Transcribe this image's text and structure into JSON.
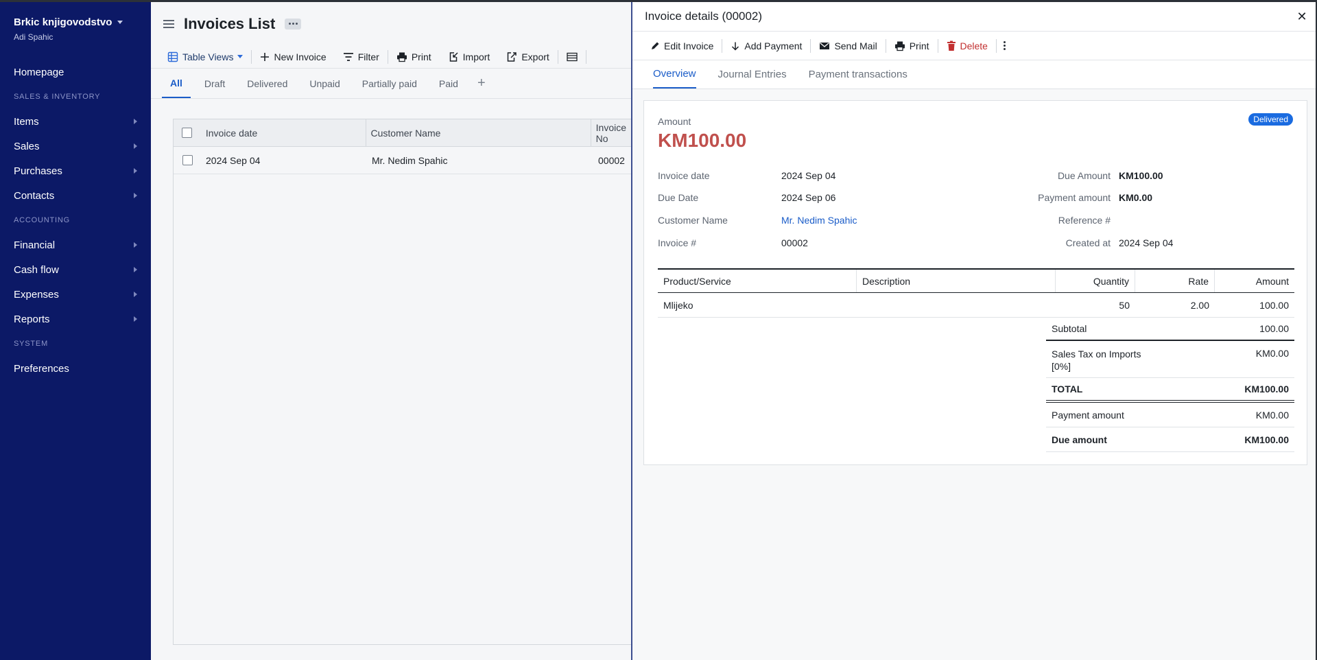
{
  "sidebar": {
    "org_name": "Brkic knjigovodstvo",
    "user_name": "Adi Spahic",
    "items": [
      {
        "label": "Homepage"
      },
      {
        "section": "SALES & INVENTORY"
      },
      {
        "label": "Items"
      },
      {
        "label": "Sales"
      },
      {
        "label": "Purchases"
      },
      {
        "label": "Contacts"
      },
      {
        "section": "ACCOUNTING"
      },
      {
        "label": "Financial"
      },
      {
        "label": "Cash flow"
      },
      {
        "label": "Expenses"
      },
      {
        "label": "Reports"
      },
      {
        "section": "SYSTEM"
      },
      {
        "label": "Preferences"
      }
    ]
  },
  "main": {
    "title": "Invoices List",
    "toolbar": {
      "table_views": "Table Views",
      "new_invoice": "New Invoice",
      "filter": "Filter",
      "print": "Print",
      "import": "Import",
      "export": "Export"
    },
    "tabs": [
      "All",
      "Draft",
      "Delivered",
      "Unpaid",
      "Partially paid",
      "Paid"
    ],
    "active_tab": "All",
    "table": {
      "columns": [
        "Invoice date",
        "Customer Name",
        "Invoice No"
      ],
      "rows": [
        {
          "date": "2024 Sep 04",
          "customer": "Mr. Nedim Spahic",
          "number": "00002"
        }
      ]
    }
  },
  "drawer": {
    "title": "Invoice details (00002)",
    "actions": {
      "edit": "Edit Invoice",
      "add_payment": "Add Payment",
      "send_mail": "Send Mail",
      "print": "Print",
      "delete": "Delete"
    },
    "tabs": [
      "Overview",
      "Journal Entries",
      "Payment transactions"
    ],
    "status": "Delivered",
    "amount_label": "Amount",
    "amount_value": "KM100.00",
    "left_fields": [
      {
        "label": "Invoice date",
        "value": "2024 Sep 04"
      },
      {
        "label": "Due Date",
        "value": "2024 Sep 06"
      },
      {
        "label": "Customer Name",
        "value": "Mr. Nedim Spahic"
      },
      {
        "label": "Invoice #",
        "value": "00002"
      }
    ],
    "right_fields": [
      {
        "label": "Due Amount",
        "value": "KM100.00"
      },
      {
        "label": "Payment amount",
        "value": "KM0.00"
      },
      {
        "label": "Reference #",
        "value": ""
      },
      {
        "label": "Created at",
        "value": "2024 Sep 04"
      }
    ],
    "items": {
      "columns": [
        "Product/Service",
        "Description",
        "Quantity",
        "Rate",
        "Amount"
      ],
      "rows": [
        {
          "product": "Mlijeko",
          "description": "",
          "quantity": "50",
          "rate": "2.00",
          "amount": "100.00"
        }
      ]
    },
    "totals": {
      "subtotal_label": "Subtotal",
      "subtotal": "100.00",
      "tax_label": "Sales Tax on Imports [0%]",
      "tax": "KM0.00",
      "total_label": "TOTAL",
      "total": "KM100.00",
      "payment_label": "Payment amount",
      "payment": "KM0.00",
      "due_label": "Due amount",
      "due": "KM100.00"
    }
  },
  "colors": {
    "sidebar_bg": "#0c1966",
    "accent": "#1a5cc8",
    "amount": "#c0504d",
    "danger": "#c23030",
    "badge": "#1a6be0"
  }
}
